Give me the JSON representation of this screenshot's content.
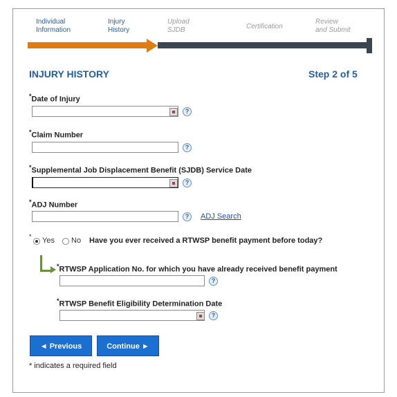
{
  "wizard": {
    "steps": [
      {
        "line1": "Individual",
        "line2": "Information",
        "state": "done"
      },
      {
        "line1": "Injury",
        "line2": "History",
        "state": "current"
      },
      {
        "line1": "Upload",
        "line2": "SJDB",
        "state": "future"
      },
      {
        "line1": "Certification",
        "line2": "",
        "state": "future"
      },
      {
        "line1": "Review",
        "line2": "and Submit",
        "state": "future"
      }
    ],
    "progress_fraction": 0.4,
    "colors": {
      "complete": "#e07a12",
      "remaining": "#3b4650"
    }
  },
  "section": {
    "title": "INJURY HISTORY",
    "step_count": "Step 2 of 5"
  },
  "required_marker": "*",
  "fields": {
    "date_of_injury": {
      "label": "Date of Injury",
      "value": ""
    },
    "claim_number": {
      "label": "Claim Number",
      "value": ""
    },
    "sjdb_service_date": {
      "label": "Supplemental Job Displacement Benefit (SJDB) Service Date",
      "value": ""
    },
    "adj_number": {
      "label": "ADJ Number",
      "value": "",
      "search_link": "ADJ Search"
    },
    "rtwsp_app_no": {
      "label": "RTWSP Application No. for which you have already received benefit payment",
      "value": ""
    },
    "rtwsp_eligibility_date": {
      "label": "RTWSP Benefit Eligibility Determination Date",
      "value": ""
    }
  },
  "help_glyph": "?",
  "question": {
    "text": "Have you ever received a RTWSP benefit payment before today?",
    "yes": "Yes",
    "no": "No",
    "selected": "Yes"
  },
  "buttons": {
    "previous": "◄ Previous",
    "continue": "Continue ►"
  },
  "footnote": "* indicates a required field",
  "icons": {
    "calendar": "calendar-icon",
    "help": "help-icon",
    "branch": "branch-arrow-icon"
  },
  "colors": {
    "heading": "#1f5fa6",
    "button": "#1a6fd1",
    "branch": "#6b8f3a"
  }
}
